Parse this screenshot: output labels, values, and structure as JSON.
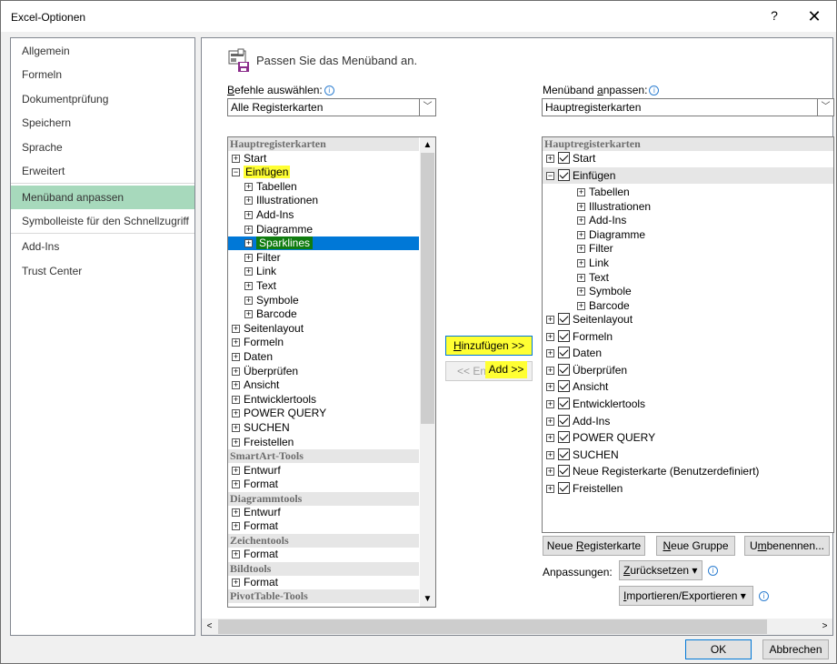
{
  "window": {
    "title": "Excel-Optionen",
    "help": "?",
    "close": "✕"
  },
  "nav": {
    "items": [
      "Allgemein",
      "Formeln",
      "Dokumentprüfung",
      "Speichern",
      "Sprache",
      "Erweitert",
      "Menüband anpassen",
      "Symbolleiste für den Schnellzugriff",
      "Add-Ins",
      "Trust Center"
    ],
    "active": "Menüband anpassen"
  },
  "header": {
    "text": "Passen Sie das Menüband an."
  },
  "left": {
    "label_pre": "B",
    "label_post": "efehle auswählen:",
    "combo_value": "Alle Registerkarten",
    "group_hauptregister": "Hauptregisterkarten",
    "start": "Start",
    "einfuegen": "Einfügen",
    "sub": [
      "Tabellen",
      "Illustrationen",
      "Add-Ins",
      "Diagramme",
      "Sparklines",
      "Filter",
      "Link",
      "Text",
      "Symbole",
      "Barcode"
    ],
    "tabs": [
      "Seitenlayout",
      "Formeln",
      "Daten",
      "Überprüfen",
      "Ansicht",
      "Entwicklertools",
      "POWER QUERY",
      "SUCHEN",
      "Freistellen"
    ],
    "group_smartart": "SmartArt-Tools",
    "smartart": [
      "Entwurf",
      "Format"
    ],
    "group_diagramm": "Diagrammtools",
    "diagramm": [
      "Entwurf",
      "Format"
    ],
    "group_zeichen": "Zeichentools",
    "zeichen": [
      "Format"
    ],
    "group_bild": "Bildtools",
    "bild": [
      "Format"
    ],
    "group_pivot": "PivotTable-Tools"
  },
  "middle": {
    "add_pre": "H",
    "add_post": "inzufügen >>",
    "remove_label": "<< En",
    "add_hint": "Add >>"
  },
  "right": {
    "label_pre": "Menüband ",
    "label_u": "a",
    "label_post": "npassen:",
    "combo_value": "Hauptregisterkarten",
    "group": "Hauptregisterkarten",
    "start": "Start",
    "einfuegen": "Einfügen",
    "sub": [
      "Tabellen",
      "Illustrationen",
      "Add-Ins",
      "Diagramme",
      "Filter",
      "Link",
      "Text",
      "Symbole",
      "Barcode"
    ],
    "tabs": [
      "Seitenlayout",
      "Formeln",
      "Daten",
      "Überprüfen",
      "Ansicht",
      "Entwicklertools",
      "Add-Ins",
      "POWER QUERY",
      "SUCHEN",
      "Neue Registerkarte (Benutzerdefiniert)",
      "Freistellen"
    ],
    "btn_new_tab_pre": "Neue ",
    "btn_new_tab_u": "R",
    "btn_new_tab_post": "egisterkarte",
    "btn_new_group_u": "N",
    "btn_new_group_post": "eue Gruppe",
    "btn_rename_pre": "U",
    "btn_rename_u": "m",
    "btn_rename_post": "benennen...",
    "customizations_label": "Anpassungen:",
    "reset_u": "Z",
    "reset_post": "urücksetzen ▾",
    "import_u": "I",
    "import_post": "mportieren/Exportieren ▾"
  },
  "footer": {
    "ok": "OK",
    "cancel": "Abbrechen"
  }
}
